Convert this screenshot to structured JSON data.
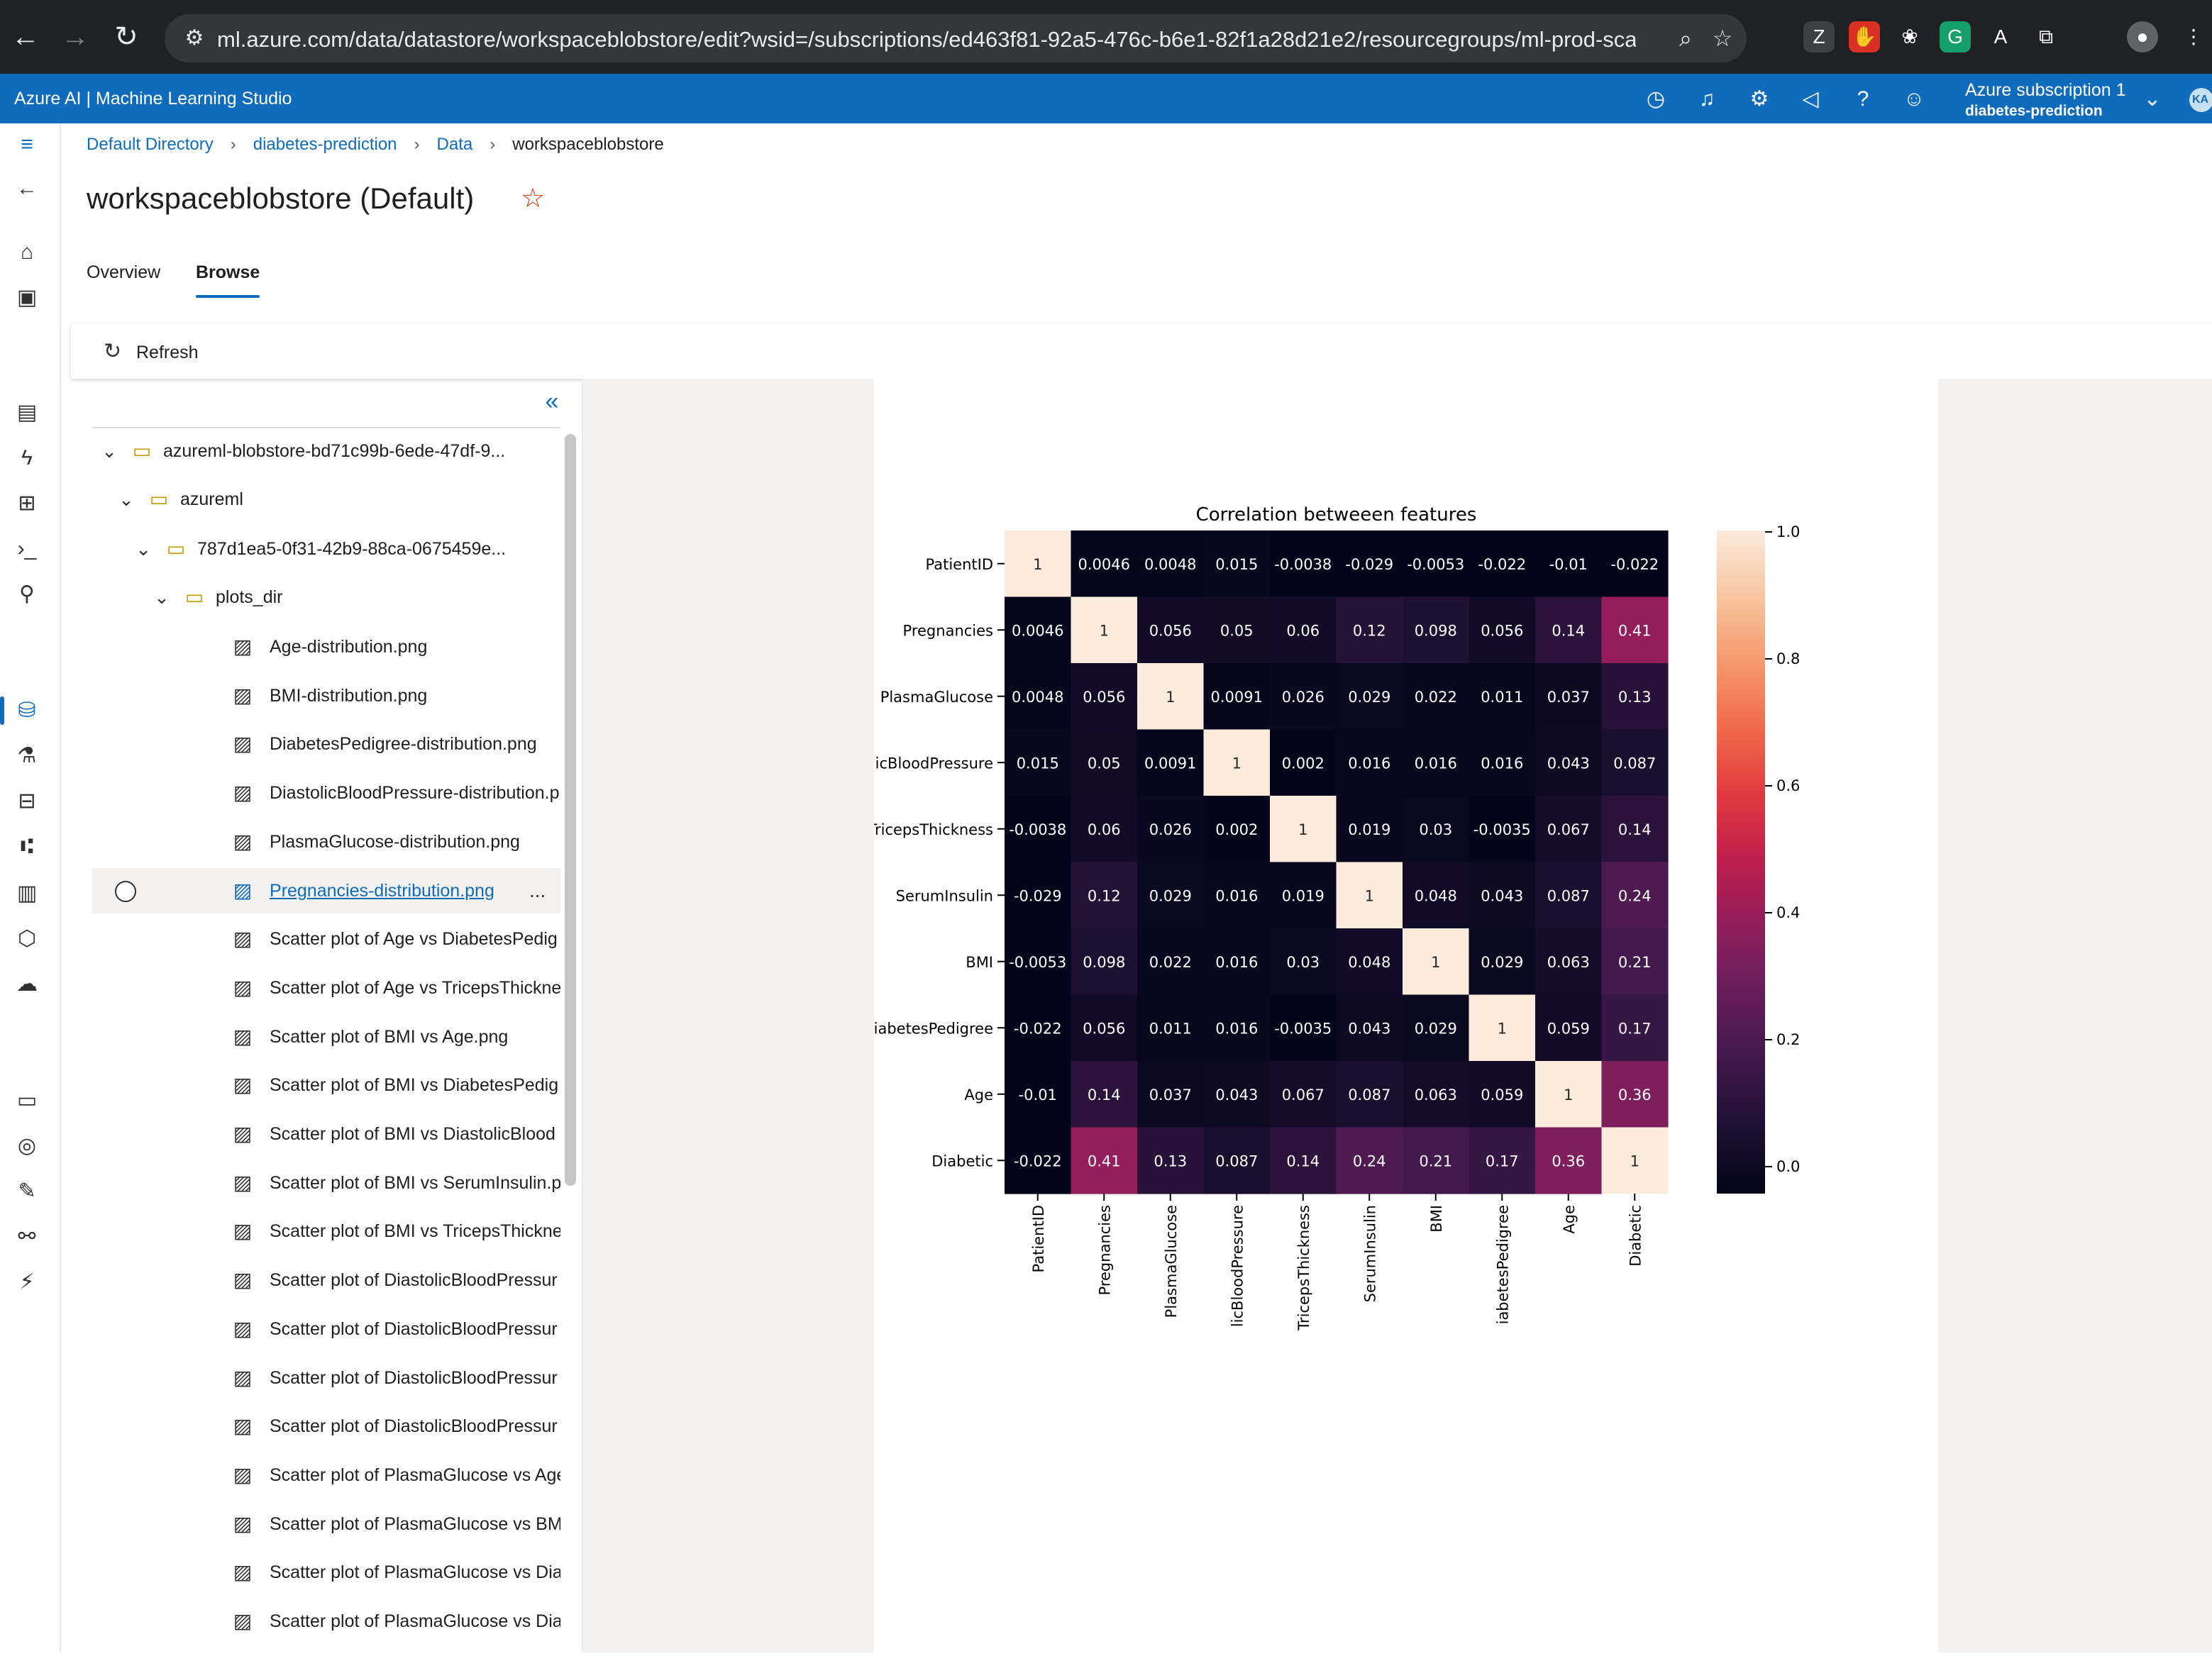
{
  "browser": {
    "url": "ml.azure.com/data/datastore/workspaceblobstore/edit?wsid=/subscriptions/ed463f81-92a5-476c-b6e1-82f1a28d21e2/resourcegroups/ml-prod-scale/w..."
  },
  "topbar": {
    "brand": "Azure AI | Machine Learning Studio",
    "subscription": "Azure subscription 1",
    "workspace": "diabetes-prediction",
    "avatar": "KA"
  },
  "breadcrumb": [
    "Default Directory",
    "diabetes-prediction",
    "Data",
    "workspaceblobstore"
  ],
  "page_title": "workspaceblobstore (Default)",
  "tabs": [
    {
      "label": "Overview",
      "selected": false
    },
    {
      "label": "Browse",
      "selected": true
    }
  ],
  "toolbar": {
    "refresh_label": "Refresh"
  },
  "tree": {
    "folders": [
      {
        "label": "azureml-blobstore-bd71c99b-6ede-47df-9...",
        "icon": "folder-icon"
      },
      {
        "label": "azureml",
        "icon": "folder-icon"
      },
      {
        "label": "787d1ea5-0f31-42b9-88ca-0675459e...",
        "icon": "folder-icon"
      },
      {
        "label": "plots_dir",
        "icon": "folder-icon"
      }
    ],
    "files": [
      "Age-distribution.png",
      "BMI-distribution.png",
      "DiabetesPedigree-distribution.png",
      "DiastolicBloodPressure-distribution.p",
      "PlasmaGlucose-distribution.png",
      "Pregnancies-distribution.png",
      "Scatter plot of Age vs DiabetesPedig",
      "Scatter plot of Age vs TricepsThickne",
      "Scatter plot of BMI vs Age.png",
      "Scatter plot of BMI vs DiabetesPedig",
      "Scatter plot of BMI vs DiastolicBlood",
      "Scatter plot of BMI vs SerumInsulin.p",
      "Scatter plot of BMI vs TricepsThickne",
      "Scatter plot of DiastolicBloodPressur",
      "Scatter plot of DiastolicBloodPressur",
      "Scatter plot of DiastolicBloodPressur",
      "Scatter plot of DiastolicBloodPressur",
      "Scatter plot of PlasmaGlucose vs Age",
      "Scatter plot of PlasmaGlucose vs BM",
      "Scatter plot of PlasmaGlucose vs Dia",
      "Scatter plot of PlasmaGlucose vs Dia"
    ],
    "selected_index": 5,
    "more_label": "..."
  },
  "chart_data": {
    "type": "heatmap",
    "title": "Correlation betweeen features",
    "row_labels": [
      "PatientID",
      "Pregnancies",
      "PlasmaGlucose",
      "licBloodPressure",
      "TricepsThickness",
      "SerumInsulin",
      "BMI",
      "iabetesPedigree",
      "Age",
      "Diabetic"
    ],
    "col_labels": [
      "PatientID",
      "Pregnancies",
      "PlasmaGlucose",
      "licBloodPressure",
      "TricepsThickness",
      "SerumInsulin",
      "BMI",
      "iabetesPedigree",
      "Age",
      "Diabetic"
    ],
    "values": [
      [
        1,
        0.0046,
        0.0048,
        0.015,
        -0.0038,
        -0.029,
        -0.0053,
        -0.022,
        -0.01,
        -0.022
      ],
      [
        0.0046,
        1,
        0.056,
        0.05,
        0.06,
        0.12,
        0.098,
        0.056,
        0.14,
        0.41
      ],
      [
        0.0048,
        0.056,
        1,
        0.0091,
        0.026,
        0.029,
        0.022,
        0.011,
        0.037,
        0.13
      ],
      [
        0.015,
        0.05,
        0.0091,
        1,
        0.002,
        0.016,
        0.016,
        0.016,
        0.043,
        0.087
      ],
      [
        -0.0038,
        0.06,
        0.026,
        0.002,
        1,
        0.019,
        0.03,
        -0.0035,
        0.067,
        0.14
      ],
      [
        -0.029,
        0.12,
        0.029,
        0.016,
        0.019,
        1,
        0.048,
        0.043,
        0.087,
        0.24
      ],
      [
        -0.0053,
        0.098,
        0.022,
        0.016,
        0.03,
        0.048,
        1,
        0.029,
        0.063,
        0.21
      ],
      [
        -0.022,
        0.056,
        0.011,
        0.016,
        -0.0035,
        0.043,
        0.029,
        1,
        0.059,
        0.17
      ],
      [
        -0.01,
        0.14,
        0.037,
        0.043,
        0.067,
        0.087,
        0.063,
        0.059,
        1,
        0.36
      ],
      [
        -0.022,
        0.41,
        0.13,
        0.087,
        0.14,
        0.24,
        0.21,
        0.17,
        0.36,
        1
      ]
    ],
    "value_labels": [
      [
        "1",
        "0.0046",
        "0.0048",
        "0.015",
        "-0.0038",
        "-0.029",
        "-0.0053",
        "-0.022",
        "-0.01",
        "-0.022"
      ],
      [
        "0.0046",
        "1",
        "0.056",
        "0.05",
        "0.06",
        "0.12",
        "0.098",
        "0.056",
        "0.14",
        "0.41"
      ],
      [
        "0.0048",
        "0.056",
        "1",
        "0.0091",
        "0.026",
        "0.029",
        "0.022",
        "0.011",
        "0.037",
        "0.13"
      ],
      [
        "0.015",
        "0.05",
        "0.0091",
        "1",
        "0.002",
        "0.016",
        "0.016",
        "0.016",
        "0.043",
        "0.087"
      ],
      [
        "-0.0038",
        "0.06",
        "0.026",
        "0.002",
        "1",
        "0.019",
        "0.03",
        "-0.0035",
        "0.067",
        "0.14"
      ],
      [
        "-0.029",
        "0.12",
        "0.029",
        "0.016",
        "0.019",
        "1",
        "0.048",
        "0.043",
        "0.087",
        "0.24"
      ],
      [
        "-0.0053",
        "0.098",
        "0.022",
        "0.016",
        "0.03",
        "0.048",
        "1",
        "0.029",
        "0.063",
        "0.21"
      ],
      [
        "-0.022",
        "0.056",
        "0.011",
        "0.016",
        "-0.0035",
        "0.043",
        "0.029",
        "1",
        "0.059",
        "0.17"
      ],
      [
        "-0.01",
        "0.14",
        "0.037",
        "0.043",
        "0.067",
        "0.087",
        "0.063",
        "0.059",
        "1",
        "0.36"
      ],
      [
        "-0.022",
        "0.41",
        "0.13",
        "0.087",
        "0.14",
        "0.24",
        "0.21",
        "0.17",
        "0.36",
        "1"
      ]
    ],
    "colorbar": {
      "min": 0.0,
      "max": 1.0,
      "ticks": [
        "0.0",
        "0.2",
        "0.4",
        "0.6",
        "0.8",
        "1.0"
      ],
      "colormap": "rocket"
    }
  },
  "colors": {
    "accent": "#0f6cbd",
    "folder": "#c19c00",
    "star": "#d83b01"
  }
}
